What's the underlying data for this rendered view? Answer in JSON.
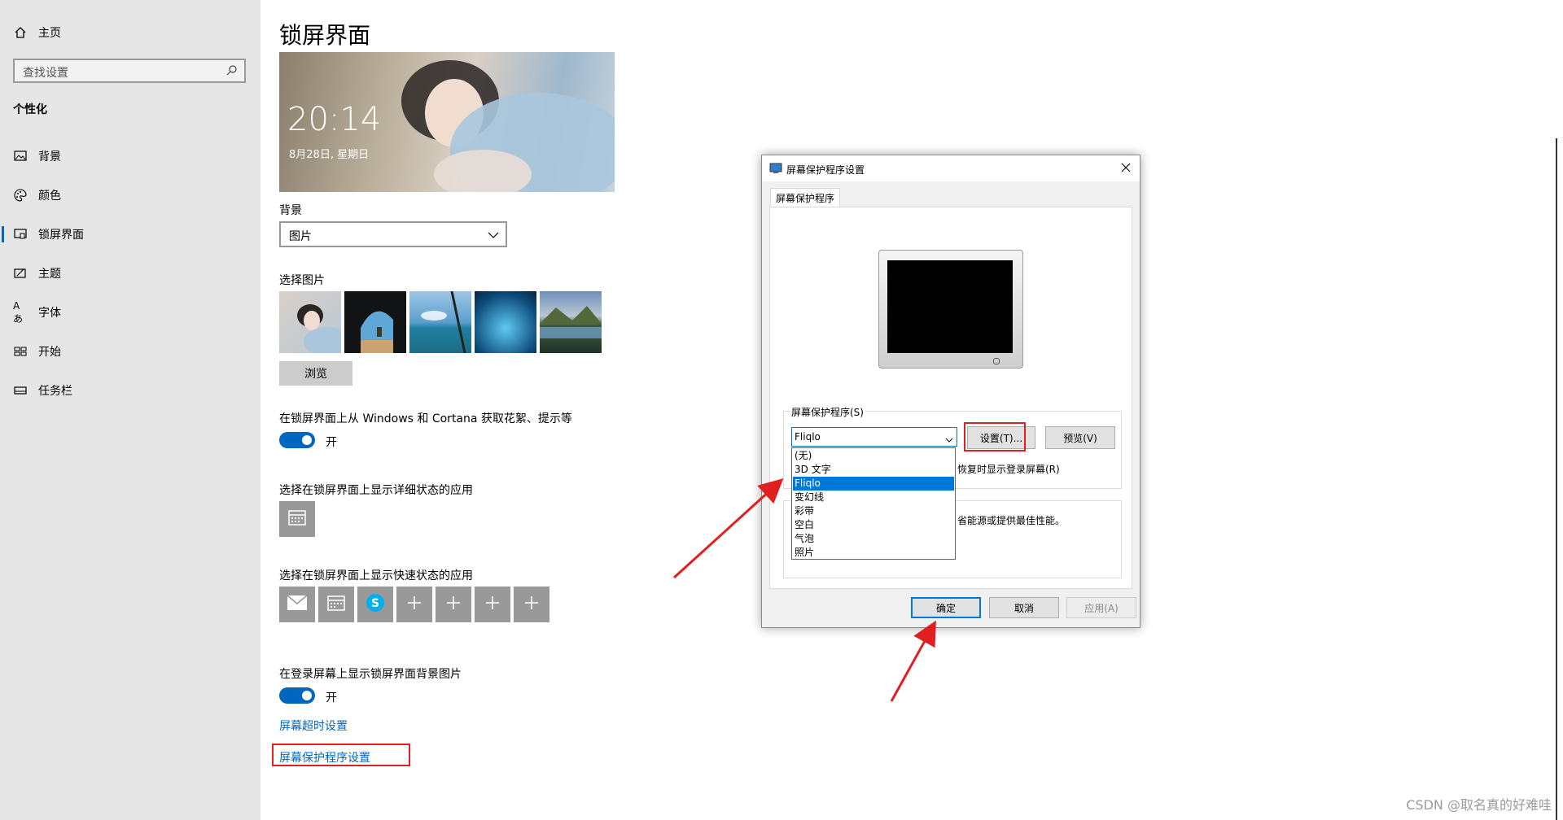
{
  "sidebar": {
    "home_label": "主页",
    "search_placeholder": "查找设置",
    "section_title": "个性化",
    "items": [
      {
        "label": "背景",
        "icon": "picture-icon"
      },
      {
        "label": "颜色",
        "icon": "palette-icon"
      },
      {
        "label": "锁屏界面",
        "icon": "lock-screen-icon"
      },
      {
        "label": "主题",
        "icon": "theme-icon"
      },
      {
        "label": "字体",
        "icon": "font-icon"
      },
      {
        "label": "开始",
        "icon": "start-icon"
      },
      {
        "label": "任务栏",
        "icon": "taskbar-icon"
      }
    ],
    "selected_index": 2
  },
  "main": {
    "page_title": "锁屏界面",
    "preview": {
      "time": "20:14",
      "date": "8月28日, 星期日"
    },
    "background_label": "背景",
    "background_value": "图片",
    "choose_picture_label": "选择图片",
    "browse_label": "浏览",
    "fun_facts_label": "在锁屏界面上从 Windows 和 Cortana 获取花絮、提示等",
    "fun_facts_state": "开",
    "detailed_status_label": "选择在锁屏界面上显示详细状态的应用",
    "quick_status_label": "选择在锁屏界面上显示快速状态的应用",
    "quick_status_apps": [
      "mail-icon",
      "calendar-icon",
      "skype-icon",
      "plus-icon",
      "plus-icon",
      "plus-icon",
      "plus-icon"
    ],
    "signin_bg_label": "在登录屏幕上显示锁屏界面背景图片",
    "signin_bg_state": "开",
    "timeout_link": "屏幕超时设置",
    "screensaver_link": "屏幕保护程序设置"
  },
  "dialog": {
    "title": "屏幕保护程序设置",
    "tab": "屏幕保护程序",
    "group_label": "屏幕保护程序(S)",
    "selected_value": "Fliqlo",
    "settings_button": "设置(T)...",
    "preview_button": "预览(V)",
    "resume_text": "恢复时显示登录屏幕(R)",
    "power_text": "省能源或提供最佳性能。",
    "options": [
      "(无)",
      "3D 文字",
      "Fliqlo",
      "变幻线",
      "彩带",
      "空白",
      "气泡",
      "照片"
    ],
    "highlighted_option": "Fliqlo",
    "ok_button": "确定",
    "cancel_button": "取消",
    "apply_button": "应用(A)"
  },
  "watermark": "CSDN @取名真的好难哇",
  "colors": {
    "accent": "#0067c0",
    "annotation_red": "#e02020",
    "sidebar_bg": "#e6e6e6"
  }
}
